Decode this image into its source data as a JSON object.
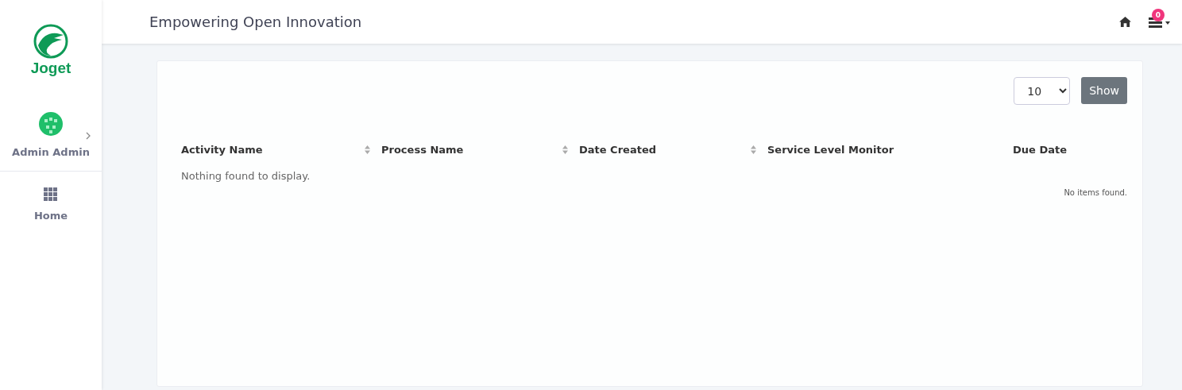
{
  "sidebar": {
    "logo_text": "Joget",
    "user": {
      "name": "Admin Admin"
    },
    "items": [
      {
        "label": "Home",
        "selected": false
      }
    ]
  },
  "header": {
    "title": "Empowering Open Innovation",
    "notification_count": "0"
  },
  "toolbar": {
    "page_size": "10",
    "show_button": "Show"
  },
  "table": {
    "columns": [
      {
        "label": "Activity Name",
        "sortable": true
      },
      {
        "label": "Process Name",
        "sortable": true
      },
      {
        "label": "Date Created",
        "sortable": true
      },
      {
        "label": "Service Level Monitor",
        "sortable": false
      },
      {
        "label": "Due Date",
        "sortable": false
      }
    ],
    "empty_message": "Nothing found to display.",
    "footer": "No items found."
  }
}
